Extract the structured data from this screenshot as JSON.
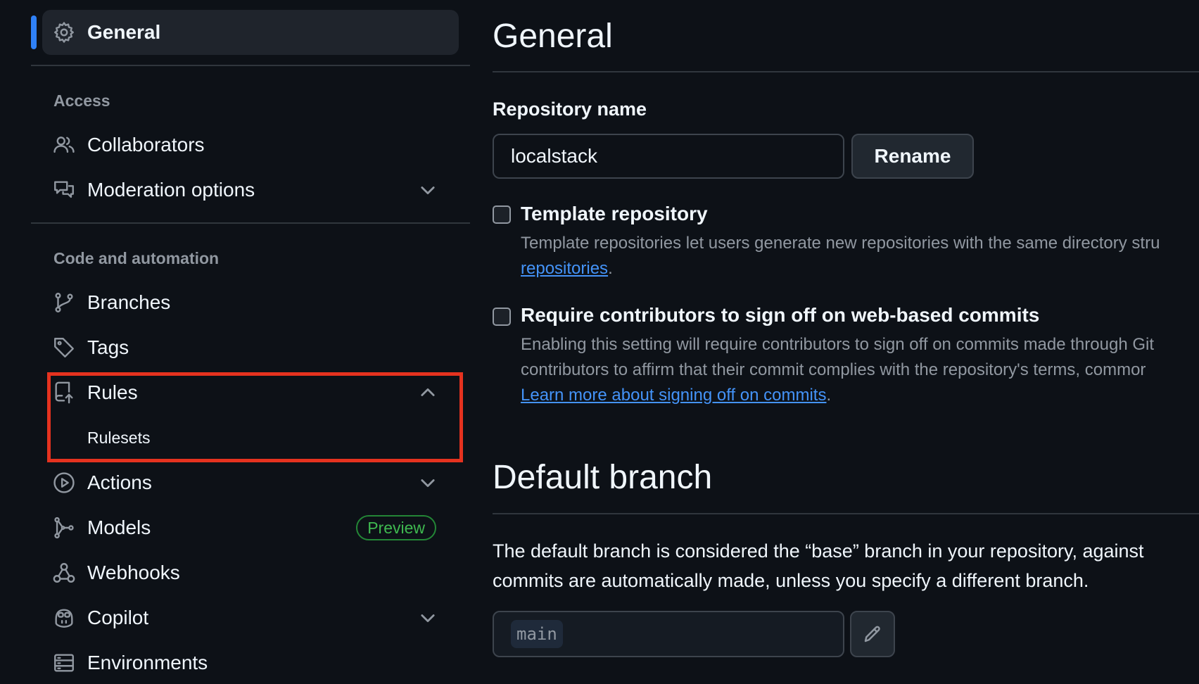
{
  "sidebar": {
    "general": "General",
    "access_title": "Access",
    "collaborators": "Collaborators",
    "moderation": "Moderation options",
    "code_title": "Code and automation",
    "branches": "Branches",
    "tags": "Tags",
    "rules": "Rules",
    "rulesets": "Rulesets",
    "actions": "Actions",
    "models": "Models",
    "preview_badge": "Preview",
    "webhooks": "Webhooks",
    "copilot": "Copilot",
    "environments": "Environments"
  },
  "main": {
    "title": "General",
    "repo_name_label": "Repository name",
    "repo_name_value": "localstack",
    "rename_button": "Rename",
    "template": {
      "title": "Template repository",
      "desc_line1": "Template repositories let users generate new repositories with the same directory stru",
      "link": "repositories",
      "after": "."
    },
    "signoff": {
      "title": "Require contributors to sign off on web-based commits",
      "desc_line1": "Enabling this setting will require contributors to sign off on commits made through Git",
      "desc_line2": "contributors to affirm that their commit complies with the repository's terms, commor",
      "link": "Learn more about signing off on commits",
      "after": "."
    },
    "default_branch_title": "Default branch",
    "default_branch_line1": "The default branch is considered the “base” branch in your repository, against",
    "default_branch_line2": "commits are automatically made, unless you specify a different branch.",
    "branch_value": "main"
  },
  "colors": {
    "background": "#0d1117",
    "accent": "#2f81f7",
    "highlight_border": "#e5321f",
    "badge_green": "#3fb950",
    "link": "#4493f8"
  }
}
